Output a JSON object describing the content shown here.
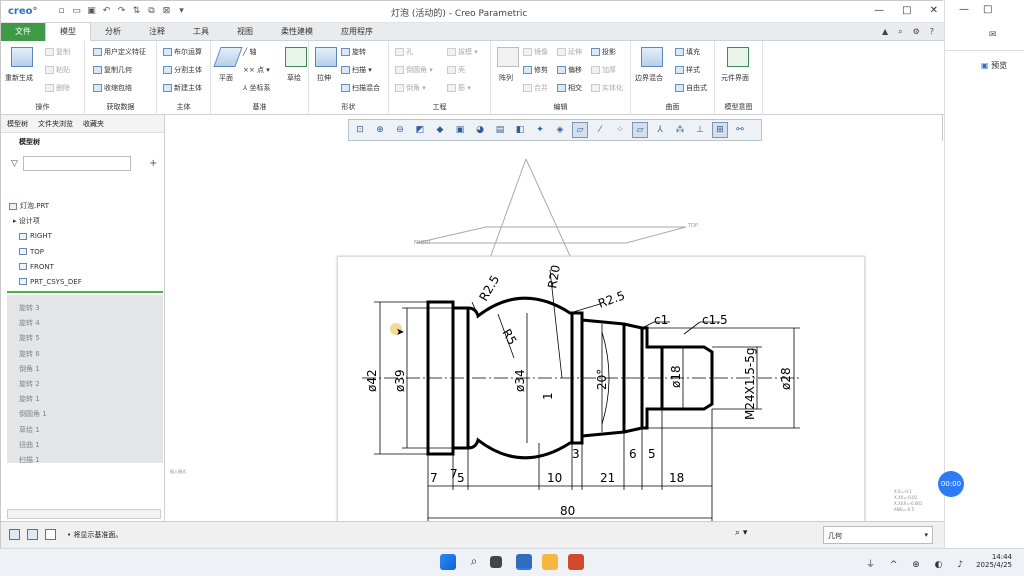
{
  "app": {
    "logo": "creo°",
    "title": "灯泡 (活动的) - Creo Parametric"
  },
  "tabs": [
    "文件",
    "模型",
    "分析",
    "注释",
    "工具",
    "视图",
    "柔性建模",
    "应用程序"
  ],
  "groups": {
    "operations": "操作",
    "get_data": "获取数据",
    "body": "主体",
    "datum": "基准",
    "shapes": "形状",
    "engineering": "工程",
    "editing": "编辑",
    "surfaces": "曲面",
    "model_intent": "模型意图"
  },
  "ribbon": {
    "regen": "重新生成",
    "copy": "复制",
    "paste": "粘贴",
    "delete": "删除",
    "udf": "用户定义特征",
    "copy_geom": "复制几何",
    "shrinkwrap": "收缩包络",
    "boolean": "布尔运算",
    "split_body": "分割主体",
    "new_body": "新建主体",
    "plane": "平面",
    "axis": "轴",
    "point": "点",
    "csys": "坐标系",
    "sketch": "草绘",
    "extrude": "拉伸",
    "revolve": "旋转",
    "sweep": "扫描",
    "swept_blend": "扫描混合",
    "hole": "孔",
    "round": "倒圆角",
    "chamfer": "倒角",
    "draft": "拔模",
    "shell": "壳",
    "rib": "筋",
    "pattern": "阵列",
    "mirror": "镜像",
    "trim": "修剪",
    "merge": "合并",
    "extend": "延伸",
    "offset": "偏移",
    "intersect": "相交",
    "project": "投影",
    "thicken": "加厚",
    "solidify": "实体化",
    "boundary_blend": "边界混合",
    "fill": "填充",
    "style": "样式",
    "freestyle": "自由式",
    "element_view": "元件界面"
  },
  "left": {
    "tab1": "模型树",
    "tab2": "文件夹浏览",
    "tab3": "收藏夹",
    "tree_header": "模型树",
    "items": [
      "灯泡.PRT",
      "设计项",
      "RIGHT",
      "TOP",
      "FRONT",
      "PRT_CSYS_DEF"
    ],
    "features": [
      "旋转 3",
      "旋转 4",
      "旋转 5",
      "旋转 6",
      "倒角 1",
      "旋转 2",
      "旋转 1",
      "倒圆角 1",
      "草绘 1",
      "扭曲 1",
      "扫描 1"
    ]
  },
  "canvas": {
    "front_label": "FRONT",
    "top_label": "TOP",
    "coords": [
      "X.0=-0.1",
      "X.XX=-0.01",
      "X.XXX=-0.001",
      "ANG=-0.5"
    ],
    "status_small": "插入模式"
  },
  "drawing": {
    "dims": [
      "R2.5",
      "R20",
      "R2.5",
      "R5",
      "c1",
      "c1.5",
      "ø42",
      "ø39",
      "ø34",
      "20°",
      "ø18",
      "M24X1.5-5g",
      "ø28",
      "1",
      "3",
      "7",
      "5",
      "10",
      "21",
      "6",
      "5",
      "18",
      "80"
    ]
  },
  "status": {
    "message": "• 将显示基准面。",
    "filter": "几何"
  },
  "right": {
    "preview": "预览"
  },
  "timer": "00:00",
  "taskbar": {
    "time": "14:44",
    "date": "2025/4/25"
  }
}
